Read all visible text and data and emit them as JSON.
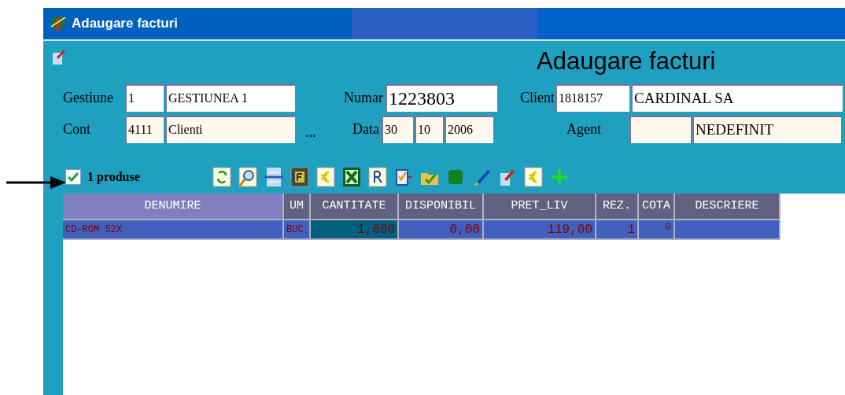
{
  "window": {
    "title": "Adaugare facturi"
  },
  "form_title": "Adaugare facturi",
  "form": {
    "gestiune": {
      "label": "Gestiune",
      "code": "1",
      "name": "GESTIUNEA 1"
    },
    "numar": {
      "label": "Numar",
      "value": "1223803"
    },
    "client": {
      "label": "Client",
      "code": "1818157",
      "name": "CARDINAL SA"
    },
    "cont": {
      "label": "Cont",
      "code": "4111",
      "name": "Clienti"
    },
    "cont_browse": "...",
    "data": {
      "label": "Data",
      "day": "30",
      "month": "10",
      "year": "2006"
    },
    "agent": {
      "label": "Agent",
      "name": "NEDEFINIT"
    }
  },
  "products": {
    "checked": true,
    "label": "1 produse"
  },
  "table": {
    "columns": [
      "DENUMIRE",
      "UM",
      "CANTITATE",
      "DISPONIBIL",
      "PRET_LIV",
      "REZ.",
      "COTA",
      "DESCRIERE"
    ],
    "rows": [
      {
        "selected": true,
        "cells": [
          {
            "text": "CD-ROM 52X",
            "focused": false
          },
          {
            "text": "BUC",
            "focused": false
          },
          {
            "text": "1,000",
            "focused": true
          },
          {
            "text": "0,00",
            "focused": false
          },
          {
            "text": "119,00",
            "focused": false
          },
          {
            "text": "1",
            "focused": false
          },
          {
            "text": "0",
            "focused": false
          }
        ]
      }
    ]
  }
}
